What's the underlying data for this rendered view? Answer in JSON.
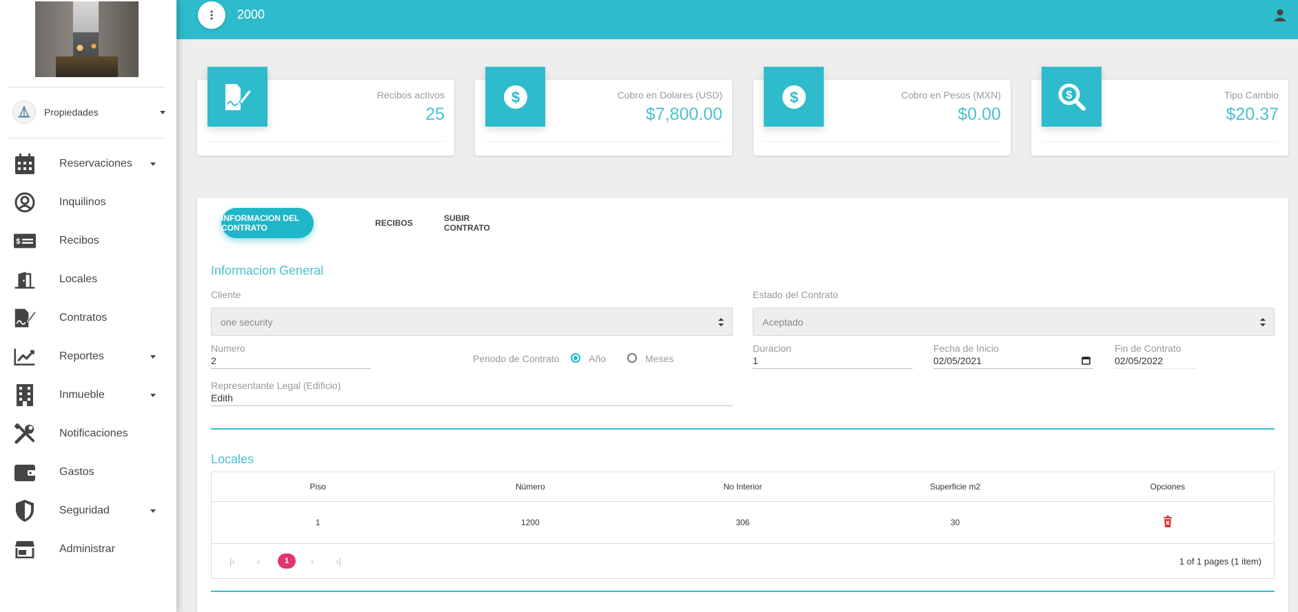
{
  "topbar": {
    "title": "2000"
  },
  "sidebar": {
    "property_selector": "Propiedades",
    "items": [
      {
        "label": "Reservaciones",
        "icon": "calendar-icon",
        "has_submenu": true
      },
      {
        "label": "Inquilinos",
        "icon": "user-circle-icon",
        "has_submenu": false
      },
      {
        "label": "Recibos",
        "icon": "money-bill-icon",
        "has_submenu": false
      },
      {
        "label": "Locales",
        "icon": "door-open-icon",
        "has_submenu": false
      },
      {
        "label": "Contratos",
        "icon": "contract-signature-icon",
        "has_submenu": false
      },
      {
        "label": "Reportes",
        "icon": "chart-line-icon",
        "has_submenu": true
      },
      {
        "label": "Inmueble",
        "icon": "building-icon",
        "has_submenu": true
      },
      {
        "label": "Notificaciones",
        "icon": "tools-icon",
        "has_submenu": false
      },
      {
        "label": "Gastos",
        "icon": "wallet-icon",
        "has_submenu": false
      },
      {
        "label": "Seguridad",
        "icon": "shield-icon",
        "has_submenu": true
      },
      {
        "label": "Administrar",
        "icon": "store-icon",
        "has_submenu": false
      }
    ]
  },
  "stats": [
    {
      "label": "Recibos activos",
      "value": "25",
      "icon": "contract-edit-icon"
    },
    {
      "label": "Cobro en Dolares (USD)",
      "value": "$7,800.00",
      "icon": "dollar-circle-icon"
    },
    {
      "label": "Cobro en Pesos (MXN)",
      "value": "$0.00",
      "icon": "dollar-circle-icon"
    },
    {
      "label": "Tipo Cambio",
      "value": "$20.37",
      "icon": "search-dollar-icon"
    }
  ],
  "tabs": [
    {
      "label": "INFORMACION DEL CONTRATO",
      "active": true
    },
    {
      "label": "RECIBOS",
      "active": false
    },
    {
      "label": "SUBIR CONTRATO",
      "active": false
    }
  ],
  "general": {
    "section_title": "Informacion General",
    "cliente_label": "Cliente",
    "cliente_value": "one security",
    "estado_label": "Estado del Contrato",
    "estado_value": "Aceptado",
    "numero_label": "Numero",
    "numero_value": "2",
    "periodo_label": "Periodo de Contrato",
    "periodo_options": [
      "Año",
      "Meses"
    ],
    "periodo_selected": "Año",
    "duracion_label": "Duracion",
    "duracion_value": "1",
    "fecha_inicio_label": "Fecha de Inicio",
    "fecha_inicio_value": "02/05/2021",
    "fin_label": "Fin de Contrato",
    "fin_value": "02/05/2022",
    "representante_label": "Representante Legal (Edificio)",
    "representante_value": "Edith"
  },
  "locales": {
    "section_title": "Locales",
    "columns": [
      "Piso",
      "Número",
      "No Interior",
      "Superficie m2",
      "Opciones"
    ],
    "rows": [
      {
        "piso": "1",
        "numero": "1200",
        "no_interior": "306",
        "superficie": "30"
      }
    ],
    "pagination": {
      "current_page": "1",
      "info": "1 of 1 pages (1 item)"
    }
  },
  "colors": {
    "accent": "#2ebccc",
    "value_text": "#4cc0cf",
    "pager_active": "#e0356f",
    "delete": "#e53935"
  }
}
